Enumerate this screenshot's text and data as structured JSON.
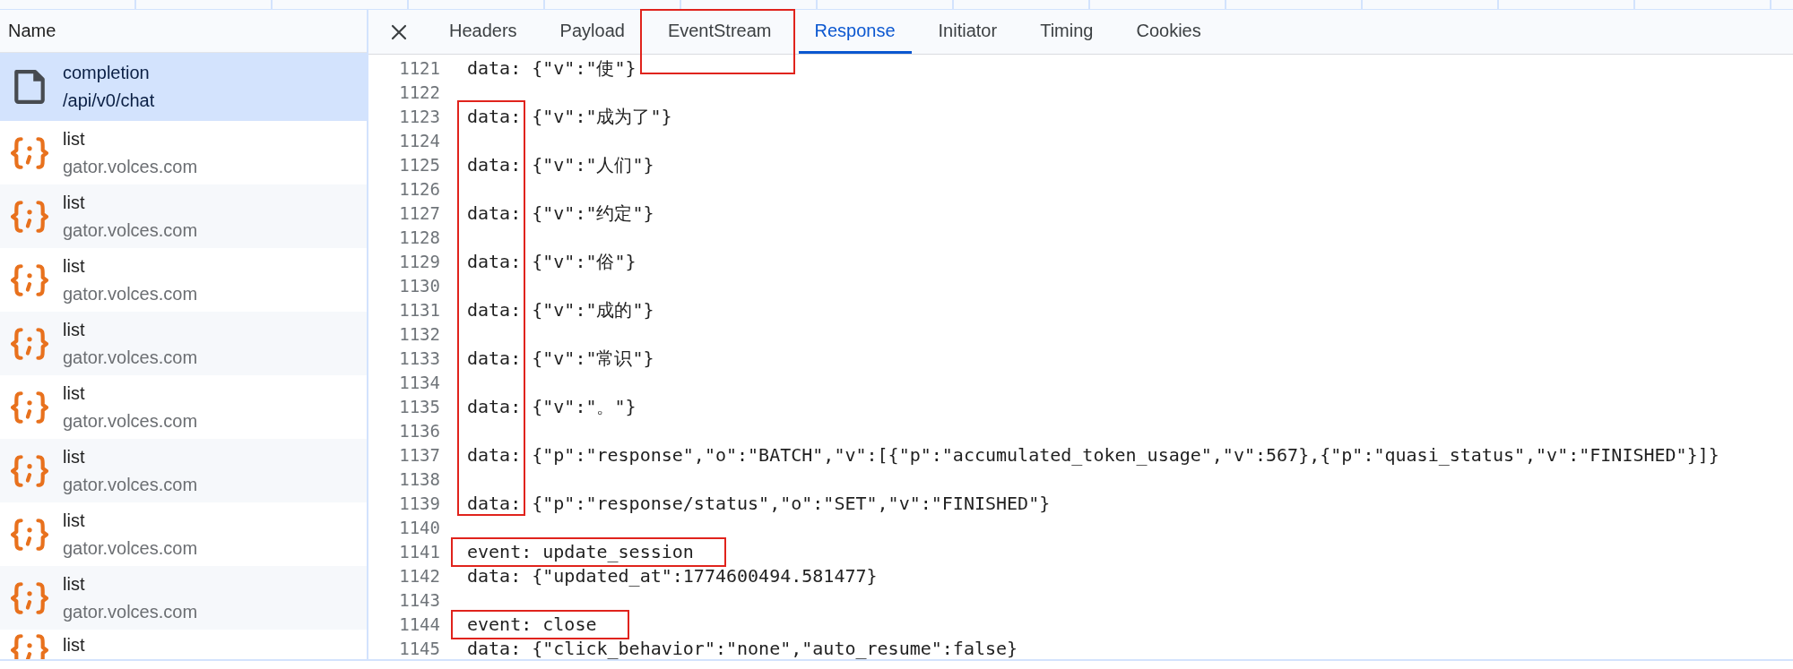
{
  "request_list": {
    "header": "Name",
    "rows": [
      {
        "kind": "document",
        "name": "completion",
        "path": "/api/v0/chat",
        "selected": true
      },
      {
        "kind": "script",
        "name": "list",
        "path": "gator.volces.com",
        "selected": false
      },
      {
        "kind": "script",
        "name": "list",
        "path": "gator.volces.com",
        "selected": false
      },
      {
        "kind": "script",
        "name": "list",
        "path": "gator.volces.com",
        "selected": false
      },
      {
        "kind": "script",
        "name": "list",
        "path": "gator.volces.com",
        "selected": false
      },
      {
        "kind": "script",
        "name": "list",
        "path": "gator.volces.com",
        "selected": false
      },
      {
        "kind": "script",
        "name": "list",
        "path": "gator.volces.com",
        "selected": false
      },
      {
        "kind": "script",
        "name": "list",
        "path": "gator.volces.com",
        "selected": false
      },
      {
        "kind": "script",
        "name": "list",
        "path": "gator.volces.com",
        "selected": false
      },
      {
        "kind": "script",
        "name": "list",
        "selected": false
      }
    ]
  },
  "detail": {
    "tabs": [
      {
        "label": "Headers",
        "selected": false
      },
      {
        "label": "Payload",
        "selected": false
      },
      {
        "label": "EventStream",
        "selected": false
      },
      {
        "label": "Response",
        "selected": true
      },
      {
        "label": "Initiator",
        "selected": false
      },
      {
        "label": "Timing",
        "selected": false
      },
      {
        "label": "Cookies",
        "selected": false
      }
    ],
    "lines": [
      {
        "num": "1121",
        "text": "data: {\"v\":\"使\"}"
      },
      {
        "num": "1122"
      },
      {
        "num": "1123",
        "text": "data: {\"v\":\"成为了\"}"
      },
      {
        "num": "1124"
      },
      {
        "num": "1125",
        "text": "data: {\"v\":\"人们\"}"
      },
      {
        "num": "1126"
      },
      {
        "num": "1127",
        "text": "data: {\"v\":\"约定\"}"
      },
      {
        "num": "1128"
      },
      {
        "num": "1129",
        "text": "data: {\"v\":\"俗\"}"
      },
      {
        "num": "1130"
      },
      {
        "num": "1131",
        "text": "data: {\"v\":\"成的\"}"
      },
      {
        "num": "1132"
      },
      {
        "num": "1133",
        "text": "data: {\"v\":\"常识\"}"
      },
      {
        "num": "1134"
      },
      {
        "num": "1135",
        "text": "data: {\"v\":\"。\"}"
      },
      {
        "num": "1136"
      },
      {
        "num": "1137",
        "text": "data: {\"p\":\"response\",\"o\":\"BATCH\",\"v\":[{\"p\":\"accumulated_token_usage\",\"v\":567},{\"p\":\"quasi_status\",\"v\":\"FINISHED\"}]}"
      },
      {
        "num": "1138"
      },
      {
        "num": "1139",
        "text": "data: {\"p\":\"response/status\",\"o\":\"SET\",\"v\":\"FINISHED\"}"
      },
      {
        "num": "1140"
      },
      {
        "num": "1141",
        "text": "event: update_session",
        "highlighted": true
      },
      {
        "num": "1142",
        "text": "data: {\"updated_at\":1774600494.581477}"
      },
      {
        "num": "1143"
      },
      {
        "num": "1144",
        "text": "event: close",
        "highlighted": true
      },
      {
        "num": "1145",
        "text": "data: {\"click_behavior\":\"none\",\"auto_resume\":false}"
      }
    ]
  }
}
